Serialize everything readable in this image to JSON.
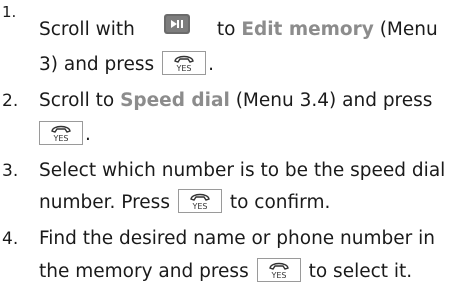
{
  "steps": [
    {
      "number": "1.",
      "text_a": "Scroll with",
      "text_b": "to",
      "highlight_1": "Edit memory",
      "text_c": "(Menu",
      "text_d": "3) and press",
      "text_e": "."
    },
    {
      "number": "2.",
      "text_a": "Scroll to",
      "highlight_1": "Speed dial",
      "text_b": "(Menu 3.4) and press",
      "text_c": "."
    },
    {
      "number": "3.",
      "text_a": "Select which number is to be the speed dial",
      "text_b": "number. Press",
      "text_c": "to confirm."
    },
    {
      "number": "4.",
      "text_a": "Find the desired name or phone number in",
      "text_b": "the memory and press",
      "text_c": "to select it."
    }
  ],
  "icons": {
    "yes_key": "YES",
    "scroll_key": "scroll-key-icon"
  },
  "colors": {
    "text": "#1a1a1a",
    "highlight": "#8c8c8c"
  }
}
